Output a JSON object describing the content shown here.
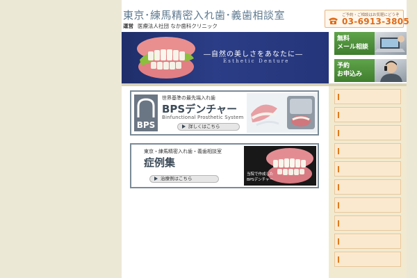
{
  "header": {
    "site_title": "東京･練馬精密入れ歯･義歯相談室",
    "operator_label": "運営",
    "operator_name": "医療法人社団 なか歯科クリニック",
    "phone_note": "ご予約・ご相談はお気軽にどうぞ",
    "phone_number": "03-6913-3805",
    "phone_icon": "telephone-icon"
  },
  "hero": {
    "catch": "―自然の美しさをあなたに―",
    "sub": "Esthetic Denture"
  },
  "side_buttons": [
    {
      "label_line1": "無料",
      "label_line2": "メール相談"
    },
    {
      "label_line1": "予約",
      "label_line2": "お申込み"
    }
  ],
  "bps_banner": {
    "tagline": "世界基準の最先端入れ歯",
    "logo_text": "BPS",
    "title": "BPSデンチャー",
    "subtitle": "Binfunctional Prosthetic System",
    "button_label": "詳しくはこちら"
  },
  "cases_banner": {
    "tagline": "東京・練馬精密入れ歯・義歯相談室",
    "title": "症例集",
    "button_label": "治療例はこちら",
    "caption_line1": "当院で作成した",
    "caption_line2": "BPSデンチャー"
  },
  "colors": {
    "accent_orange": "#e06a14",
    "hero_navy": "#24357a",
    "side_green": "#4f9140",
    "bullet_orange": "#e07a1c"
  }
}
